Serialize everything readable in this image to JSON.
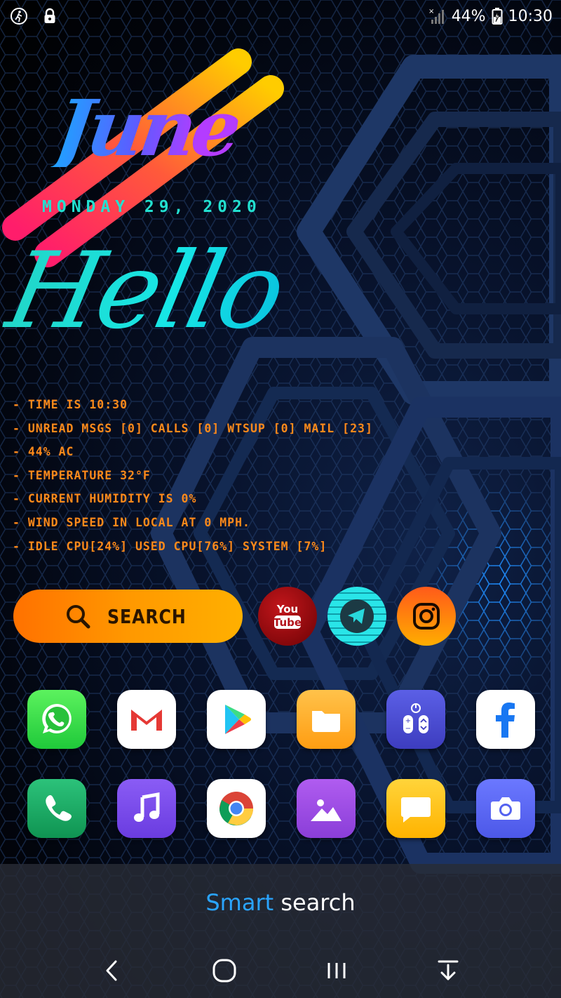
{
  "status_bar": {
    "battery": "44%",
    "time": "10:30"
  },
  "widget": {
    "month": "June",
    "date": "MONDAY 29, 2020",
    "greeting": "Hello",
    "info": [
      "- TIME IS 10:30",
      "- UNREAD MSGS [0] CALLS [0] WTSUP [0] MAIL [23]",
      "- 44% AC",
      "- TEMPERATURE 32°F",
      "- CURRENT HUMIDITY IS 0%",
      "- WIND SPEED IN LOCAL AT 0 MPH.",
      "- IDLE CPU[24%] USED CPU[76%] SYSTEM [7%]"
    ]
  },
  "search": {
    "label": "SEARCH"
  },
  "social_icons": {
    "youtube_top": "You",
    "youtube_bottom": "Tube"
  },
  "smart_search": {
    "accent": "Smart",
    "rest": " search"
  },
  "colors": {
    "accent_blue": "#2aa4ff",
    "info_orange": "#ff8a1a",
    "date_teal": "#22e0d0"
  }
}
